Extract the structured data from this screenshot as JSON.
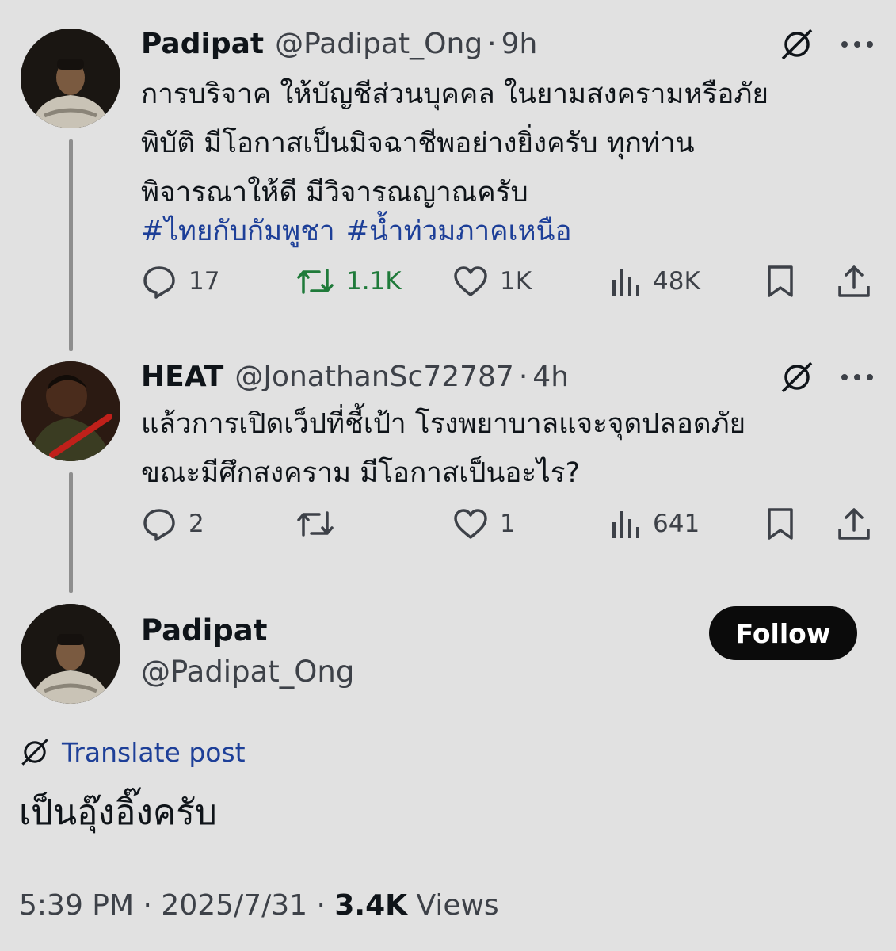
{
  "tweets": [
    {
      "name": "Padipat",
      "handle": "@Padipat_Ong",
      "separator": "·",
      "time": "9h",
      "text": "การบริจาค ให้บัญชีส่วนบุคคล ในยามสงครามหรือภัย\nพิบัติ มีโอกาสเป็นมิจฉาชีพอย่างยิ่งครับ ทุกท่าน\nพิจารณาให้ดี มีวิจารณญาณครับ",
      "hashtags": [
        "#ไทยกับกัมพูชา",
        "#น้ำท่วมภาคเหนือ"
      ],
      "replies": "17",
      "reposts": "1.1K",
      "likes": "1K",
      "views": "48K"
    },
    {
      "name": "HEAT",
      "handle": "@JonathanSc72787",
      "separator": "·",
      "time": "4h",
      "text": "แล้วการเปิดเว็ปที่ชี้เป้า โรงพยาบาลแจะจุดปลอดภัย\nขณะมีศึกสงคราม มีโอกาสเป็นอะไร?",
      "replies": "2",
      "likes": "1",
      "views": "641"
    }
  ],
  "main_post": {
    "name": "Padipat",
    "handle": "@Padipat_Ong",
    "follow_label": "Follow",
    "translate_label": "Translate post",
    "text": "เป็นอุ๊งอิ๊งครับ",
    "time": "5:39 PM",
    "separator": "·",
    "date": "2025/7/31",
    "views_count": "3.4K",
    "views_label": "Views"
  },
  "icons": {
    "grok": "grok-icon",
    "more": "more-icon",
    "reply": "reply-icon",
    "repost": "repost-icon",
    "like": "like-icon",
    "views": "views-icon",
    "bookmark": "bookmark-icon",
    "share": "share-icon"
  },
  "colors": {
    "background": "#e1e1e1",
    "text": "#0f1419",
    "secondary": "#3d4148",
    "hashtag": "#1d3f98",
    "repost_active": "#1f7a3a",
    "follow_button": "#0b0b0b"
  }
}
